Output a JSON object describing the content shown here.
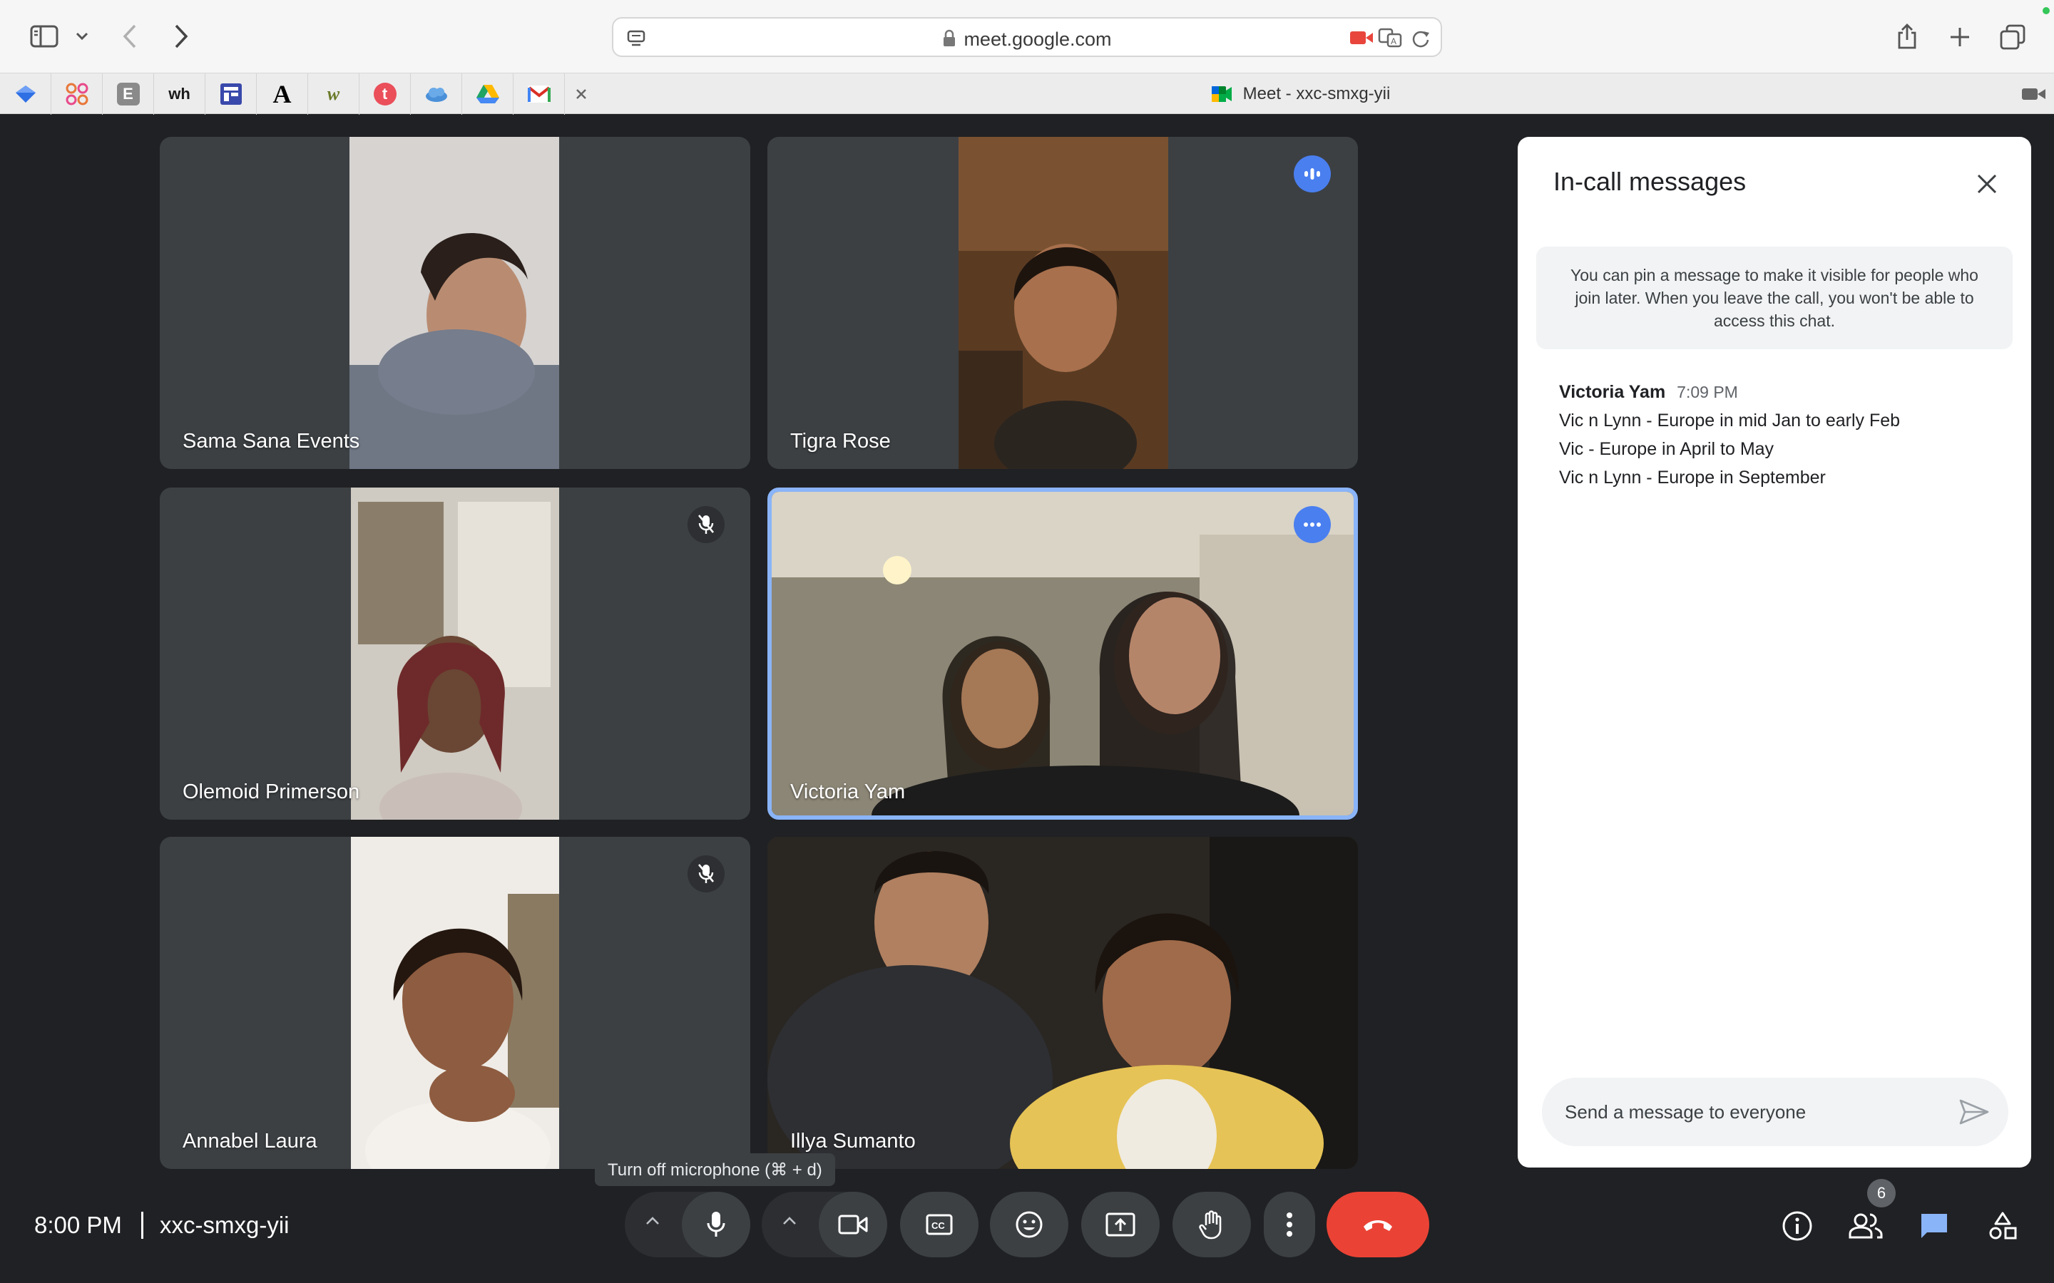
{
  "browser": {
    "url": "meet.google.com",
    "active_tab_title": "Meet - xxc-smxg-yii",
    "pinned_tabs": [
      {
        "icon": "blue-diamond-favicon",
        "color": "#2f6fe4"
      },
      {
        "icon": "pattern-favicon",
        "color": "#e8773a"
      },
      {
        "icon": "e-favicon",
        "label": "E",
        "color": "#8a8a8a"
      },
      {
        "icon": "wh-favicon",
        "label": "wh",
        "color": "#1a1a1a"
      },
      {
        "icon": "layout-favicon",
        "color": "#3949ab"
      },
      {
        "icon": "a-favicon",
        "label": "A",
        "color": "#000000"
      },
      {
        "icon": "w-favicon",
        "label": "w",
        "color": "#6b7b2a"
      },
      {
        "icon": "t-favicon",
        "label": "t",
        "color": "#ea4f5a"
      },
      {
        "icon": "cloud-favicon",
        "color": "#4a90d9"
      },
      {
        "icon": "drive-favicon",
        "color": "#1fa463"
      },
      {
        "icon": "gmail-favicon",
        "color": "#d93025"
      }
    ]
  },
  "participants": [
    {
      "name": "Sama Sana Events",
      "status": "none"
    },
    {
      "name": "Tigra Rose",
      "status": "speaking"
    },
    {
      "name": "Olemoid Primerson",
      "status": "muted"
    },
    {
      "name": "Victoria Yam",
      "status": "speaking-active"
    },
    {
      "name": "Annabel Laura",
      "status": "muted"
    },
    {
      "name": "Illya Sumanto",
      "status": "none"
    }
  ],
  "chat": {
    "title": "In-call messages",
    "pin_note": "You can pin a message to make it visible for people who join later. When you leave the call, you won't be able to access this chat.",
    "message": {
      "sender": "Victoria Yam",
      "time": "7:09 PM",
      "lines": [
        "Vic n Lynn - Europe in mid Jan to early Feb",
        "Vic - Europe in April to May",
        "Vic n Lynn - Europe in September"
      ]
    },
    "input_placeholder": "Send a message to everyone"
  },
  "bottom_bar": {
    "time": "8:00 PM",
    "meeting_code": "xxc-smxg-yii",
    "tooltip": "Turn off microphone (⌘ + d)",
    "participant_count": "6"
  },
  "colors": {
    "background": "#202124",
    "tile": "#3c4043",
    "accent": "#8ab4f8",
    "speaking": "#4a7ff0",
    "end_call": "#ea4335"
  }
}
